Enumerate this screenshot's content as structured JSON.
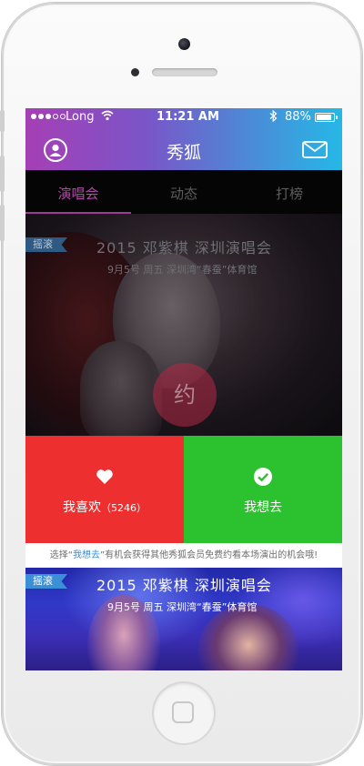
{
  "status_bar": {
    "carrier": "Long",
    "time": "11:21 AM",
    "battery": "88%",
    "battery_level": 0.88
  },
  "header": {
    "title": "秀狐",
    "left_icon": "user-icon",
    "right_icon": "mail-icon"
  },
  "tabs": [
    {
      "label": "演唱会",
      "active": true
    },
    {
      "label": "动态",
      "active": false
    },
    {
      "label": "打榜",
      "active": false
    }
  ],
  "featured": {
    "tag": "摇滚",
    "title": "2015  邓紫棋  深圳演唱会",
    "subtitle": "9月5号 周五 深圳湾“春蚕”体育馆",
    "badge": "约"
  },
  "actions": {
    "like": {
      "label": "我喜欢",
      "count": "（5246）",
      "icon": "heart-icon",
      "color": "#ed2f2f"
    },
    "go": {
      "label": "我想去",
      "icon": "check-circle-icon",
      "color": "#2cc12e"
    }
  },
  "info": {
    "prefix": "选择“",
    "highlight": "我想去",
    "suffix": "”有机会获得其他秀狐会员免费约看本场演出的机会哦!"
  },
  "second_card": {
    "tag": "摇滚",
    "title": "2015  邓紫棋  深圳演唱会",
    "subtitle": "9月5号 周五 深圳湾“春蚕”体育馆"
  },
  "colors": {
    "header_gradient": [
      "#a63fb5",
      "#25b8e6"
    ],
    "accent": "#b24aa7",
    "tag_blue": "#3a8fd6"
  }
}
